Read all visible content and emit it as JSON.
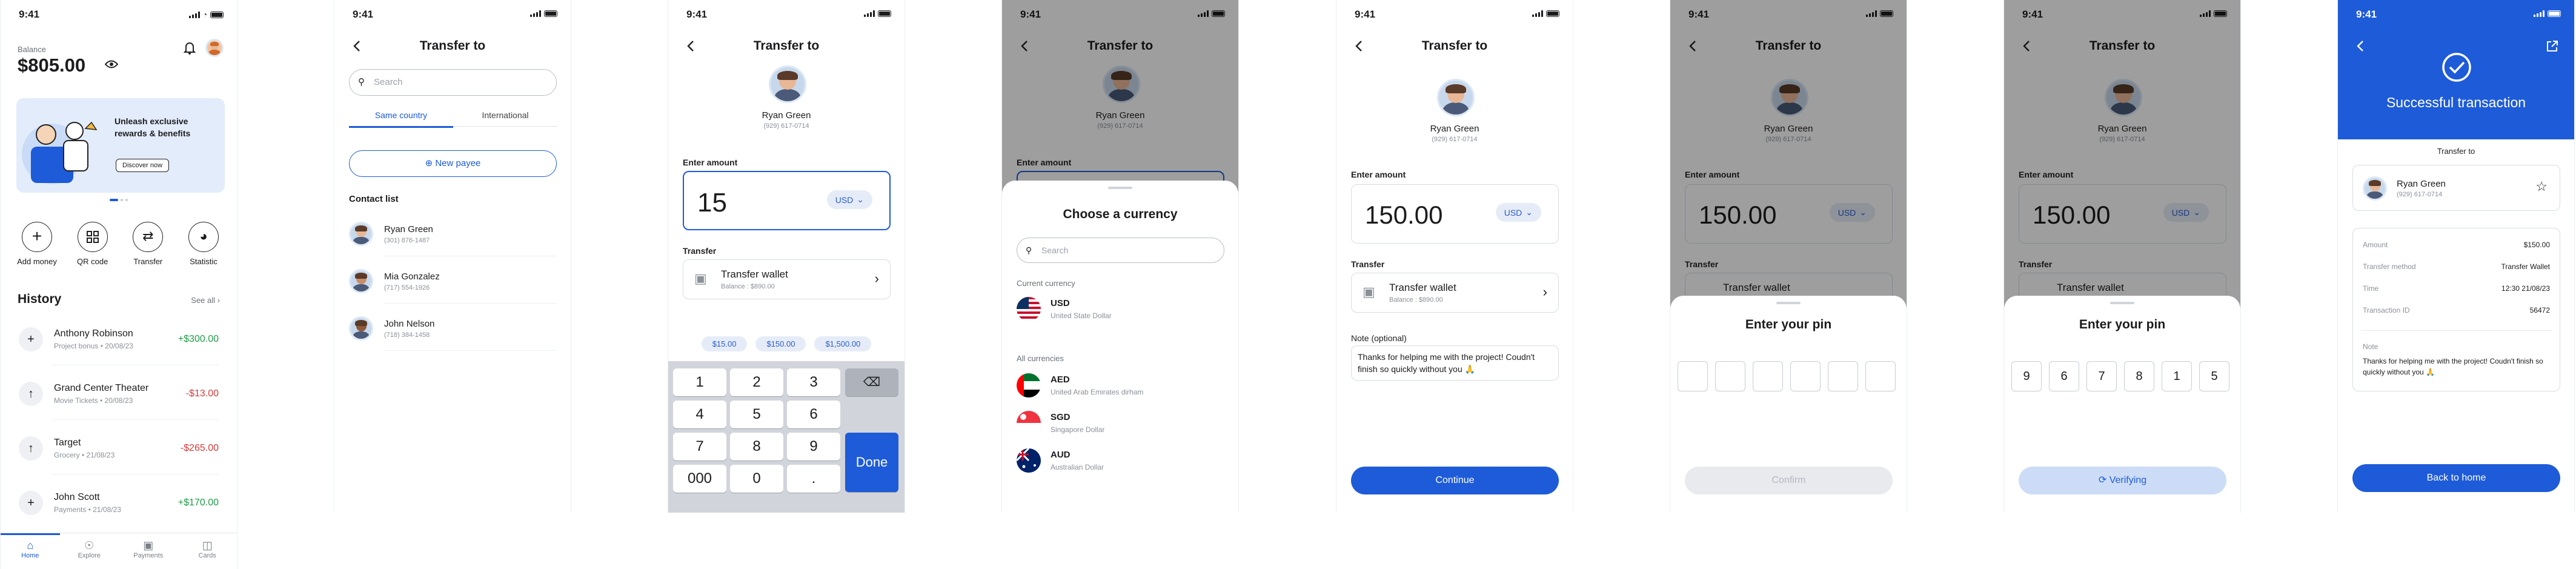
{
  "status_time": "9:41",
  "colors": {
    "accent": "#1e5bd8",
    "positive": "#1f9d45",
    "negative": "#d63a3a"
  },
  "home": {
    "balance_label": "Balance",
    "balance_value": "$805.00",
    "promo_title_1": "Unleash exclusive",
    "promo_title_2": "rewards & benefits",
    "promo_button": "Discover now",
    "actions": [
      "Add money",
      "QR code",
      "Transfer",
      "Statistic"
    ],
    "history_title": "History",
    "see_all": "See all",
    "history": [
      {
        "name": "Anthony Robinson",
        "sub": "Project bonus • 20/08/23",
        "amount": "+$300.00",
        "kind": "positive",
        "icon": "plus-icon"
      },
      {
        "name": "Grand Center Theater",
        "sub": "Movie Tickets • 20/08/23",
        "amount": "-$13.00",
        "kind": "negative",
        "icon": "arrow-up-icon"
      },
      {
        "name": "Target",
        "sub": "Grocery • 21/08/23",
        "amount": "-$265.00",
        "kind": "negative",
        "icon": "arrow-up-icon"
      },
      {
        "name": "John Scott",
        "sub": "Payments • 21/08/23",
        "amount": "+$170.00",
        "kind": "positive",
        "icon": "plus-icon"
      }
    ],
    "tabs": [
      "Home",
      "Explore",
      "Payments",
      "Cards"
    ]
  },
  "transfer_list": {
    "title": "Transfer to",
    "search_placeholder": "Search",
    "tab_same": "Same country",
    "tab_intl": "International",
    "new_payee": "New payee",
    "contacts_title": "Contact list",
    "contacts": [
      {
        "name": "Ryan Green",
        "phone": "(301) 876-1487"
      },
      {
        "name": "Mia Gonzalez",
        "phone": "(717) 554-1926"
      },
      {
        "name": "John Nelson",
        "phone": "(718) 384-1458"
      }
    ]
  },
  "payee": {
    "name": "Ryan Green",
    "phone": "(929) 617-0714"
  },
  "amount_screen": {
    "enter_amount": "Enter amount",
    "amount": "15",
    "currency": "USD",
    "transfer_label": "Transfer",
    "wallet": "Transfer wallet",
    "wallet_balance": "Balance : $890.00",
    "quick": [
      "$15.00",
      "$150.00",
      "$1,500.00"
    ],
    "keys": [
      "1",
      "2",
      "3",
      "4",
      "5",
      "6",
      "7",
      "8",
      "9",
      "000",
      "0",
      "."
    ],
    "done": "Done"
  },
  "currency_sheet": {
    "title": "Choose a currency",
    "search": "Search",
    "current_label": "Current currency",
    "current": {
      "code": "USD",
      "name": "United State Dollar"
    },
    "all_label": "All currencies",
    "all": [
      {
        "code": "AED",
        "name": "United Arab Emirates dirham"
      },
      {
        "code": "SGD",
        "name": "Singapore Dollar"
      },
      {
        "code": "AUD",
        "name": "Australian Dollar"
      }
    ]
  },
  "note_screen": {
    "amount": "150.00",
    "note_label": "Note (optional)",
    "note_text": "Thanks for helping me with the project! Coudn't finish so quickly without you 🙏",
    "continue": "Continue"
  },
  "pin": {
    "title": "Enter your pin",
    "confirm": "Confirm",
    "digits": [
      "9",
      "6",
      "7",
      "8",
      "1",
      "5"
    ],
    "verifying": "Verifying"
  },
  "success": {
    "title": "Successful transaction",
    "transfer_to": "Transfer to",
    "rows": [
      {
        "k": "Amount",
        "v": "$150.00"
      },
      {
        "k": "Transfer method",
        "v": "Transfer Wallet"
      },
      {
        "k": "Time",
        "v": "12:30 21/08/23"
      },
      {
        "k": "Transaction ID",
        "v": "56472"
      }
    ],
    "note_label": "Note",
    "note_text": "Thanks for helping me with the project! Coudn't finish so quickly without you 🙏",
    "back_home": "Back to home"
  }
}
